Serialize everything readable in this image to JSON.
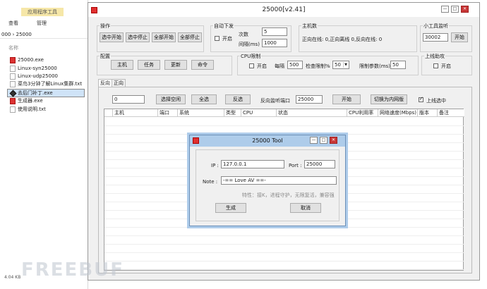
{
  "explorer": {
    "ribbon_context": "应用程序工具",
    "tab_view": "查看",
    "tab_manage": "管理",
    "address": "000  ›  25000",
    "column_name": "名称",
    "files": [
      {
        "name": "25000.exe",
        "type": "exe"
      },
      {
        "name": "Linux-syn25000",
        "type": "file"
      },
      {
        "name": "Linux-udp25000",
        "type": "file"
      },
      {
        "name": "菜鸟3分钟了解Linux集群.txt",
        "type": "file"
      },
      {
        "name": "去后门补丁.exe",
        "type": "bin"
      },
      {
        "name": "生成器.exe",
        "type": "exe"
      },
      {
        "name": "使用说明.txt",
        "type": "file"
      }
    ],
    "status": "4.04 KB"
  },
  "main": {
    "title": "25000[v2.41]",
    "ops": {
      "label": "操作",
      "buttons": [
        "选中开始",
        "选中停止",
        "全部开始",
        "全部停止"
      ]
    },
    "auto": {
      "label": "自动下发",
      "enable": "开启",
      "count_label": "次数",
      "count_value": "5",
      "interval_label": "间隔(ms)",
      "interval_value": "1000"
    },
    "hosts": {
      "label": "主机数",
      "text": "正向在线:  0,正向离线  0,反向在线:  0"
    },
    "monitor": {
      "label": "小工具监听",
      "port": "30002",
      "button": "开始"
    },
    "config": {
      "label": "配置",
      "buttons": [
        "主机",
        "任务",
        "更新",
        "命令"
      ]
    },
    "cpu": {
      "label": "CPU限制",
      "enable": "开启",
      "every_label": "每隔",
      "every_value": "500",
      "check_label": "检查限制%",
      "check_value": "50",
      "limit_label": "限制参数(ms)",
      "limit_value": "50"
    },
    "assist": {
      "label": "上线助攻",
      "enable": "开启"
    },
    "tabs": [
      "反向",
      "正向"
    ],
    "toolbar": {
      "input_value": "0",
      "select_empty": "选择空闲",
      "select_all": "全选",
      "invert": "反选",
      "listen_port_label": "反向监听端口",
      "listen_port": "25000",
      "start": "开始",
      "switch_intranet": "切换为内网版",
      "online_select_label": "上线选中"
    },
    "columns": [
      "主机",
      "端口",
      "系统",
      "类型",
      "CPU",
      "状态",
      "CPU利用率",
      "网络速度(Mbps)",
      "版本",
      "备注"
    ]
  },
  "dialog": {
    "title": "25000 Tool",
    "ip_label": "IP :",
    "ip_value": "127.0.0.1",
    "port_label": "Port :",
    "port_value": "25000",
    "note_label": "Note :",
    "note_value": "-== Love AV ==-",
    "features": "特性：接K，进程守护，无限复活，兼容强",
    "generate": "生成",
    "cancel": "取消"
  },
  "watermark": "FREEBUF"
}
